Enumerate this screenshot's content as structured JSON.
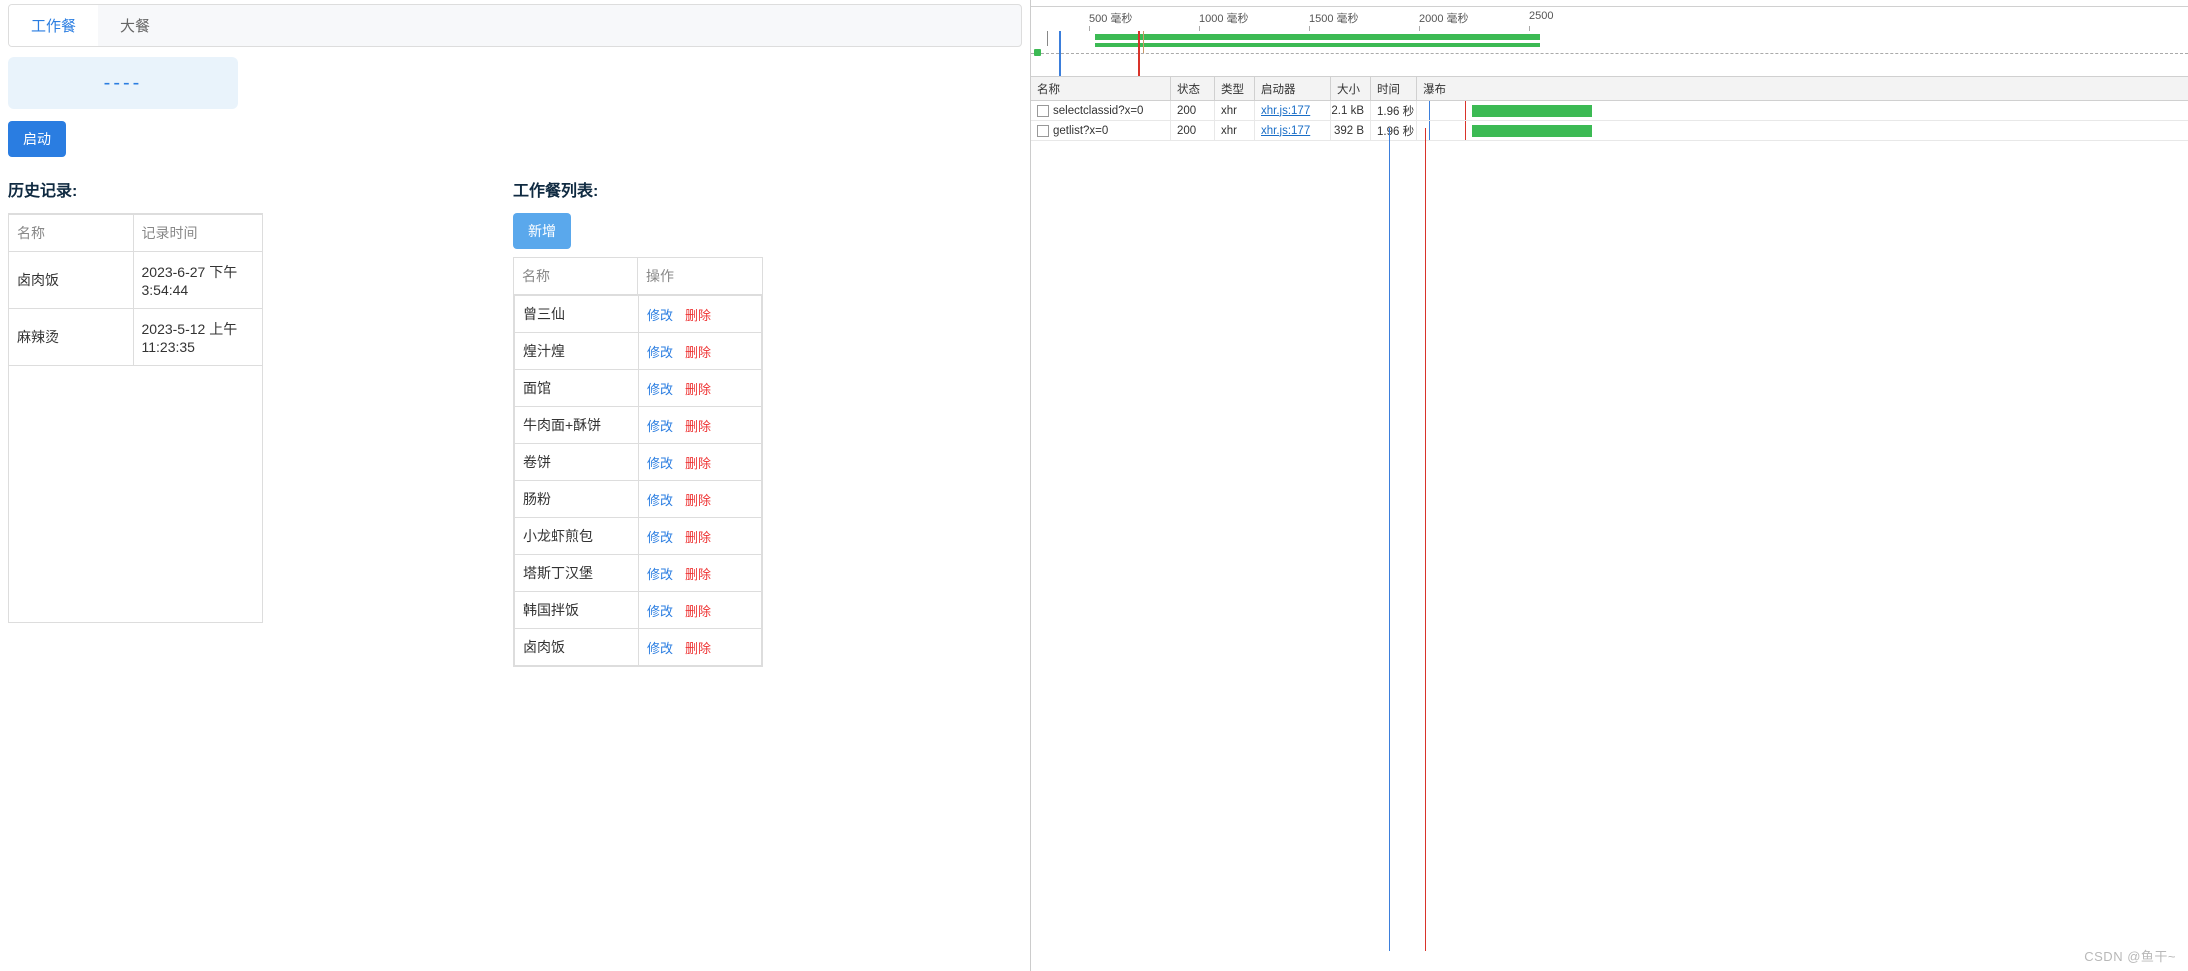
{
  "app": {
    "tabs": [
      {
        "label": "工作餐",
        "active": true
      },
      {
        "label": "大餐",
        "active": false
      }
    ],
    "result_placeholder": "----",
    "start_button": "启动",
    "history": {
      "title": "历史记录:",
      "columns": [
        "名称",
        "记录时间"
      ],
      "rows": [
        {
          "name": "卤肉饭",
          "time": "2023-6-27 下午3:54:44"
        },
        {
          "name": "麻辣烫",
          "time": "2023-5-12 上午11:23:35"
        }
      ]
    },
    "list": {
      "title": "工作餐列表:",
      "add_button": "新增",
      "columns": [
        "名称",
        "操作"
      ],
      "edit_label": "修改",
      "delete_label": "删除",
      "rows": [
        {
          "name": "曾三仙"
        },
        {
          "name": "煌汁煌"
        },
        {
          "name": "面馆"
        },
        {
          "name": "牛肉面+酥饼"
        },
        {
          "name": "卷饼"
        },
        {
          "name": "肠粉"
        },
        {
          "name": "小龙虾煎包"
        },
        {
          "name": "塔斯丁汉堡"
        },
        {
          "name": "韩国拌饭"
        },
        {
          "name": "卤肉饭"
        }
      ]
    }
  },
  "devtools": {
    "timeline_ticks": [
      "500 毫秒",
      "1000 毫秒",
      "1500 毫秒",
      "2000 毫秒",
      "2500"
    ],
    "columns": [
      "名称",
      "状态",
      "类型",
      "启动器",
      "大小",
      "时间",
      "瀑布"
    ],
    "requests": [
      {
        "name": "selectclassid?x=0",
        "status": "200",
        "type": "xhr",
        "initiator": "xhr.js:177",
        "size": "2.1 kB",
        "time": "1.96 秒"
      },
      {
        "name": "getlist?x=0",
        "status": "200",
        "type": "xhr",
        "initiator": "xhr.js:177",
        "size": "392 B",
        "time": "1.96 秒"
      }
    ]
  },
  "watermark": "CSDN @鱼干~"
}
